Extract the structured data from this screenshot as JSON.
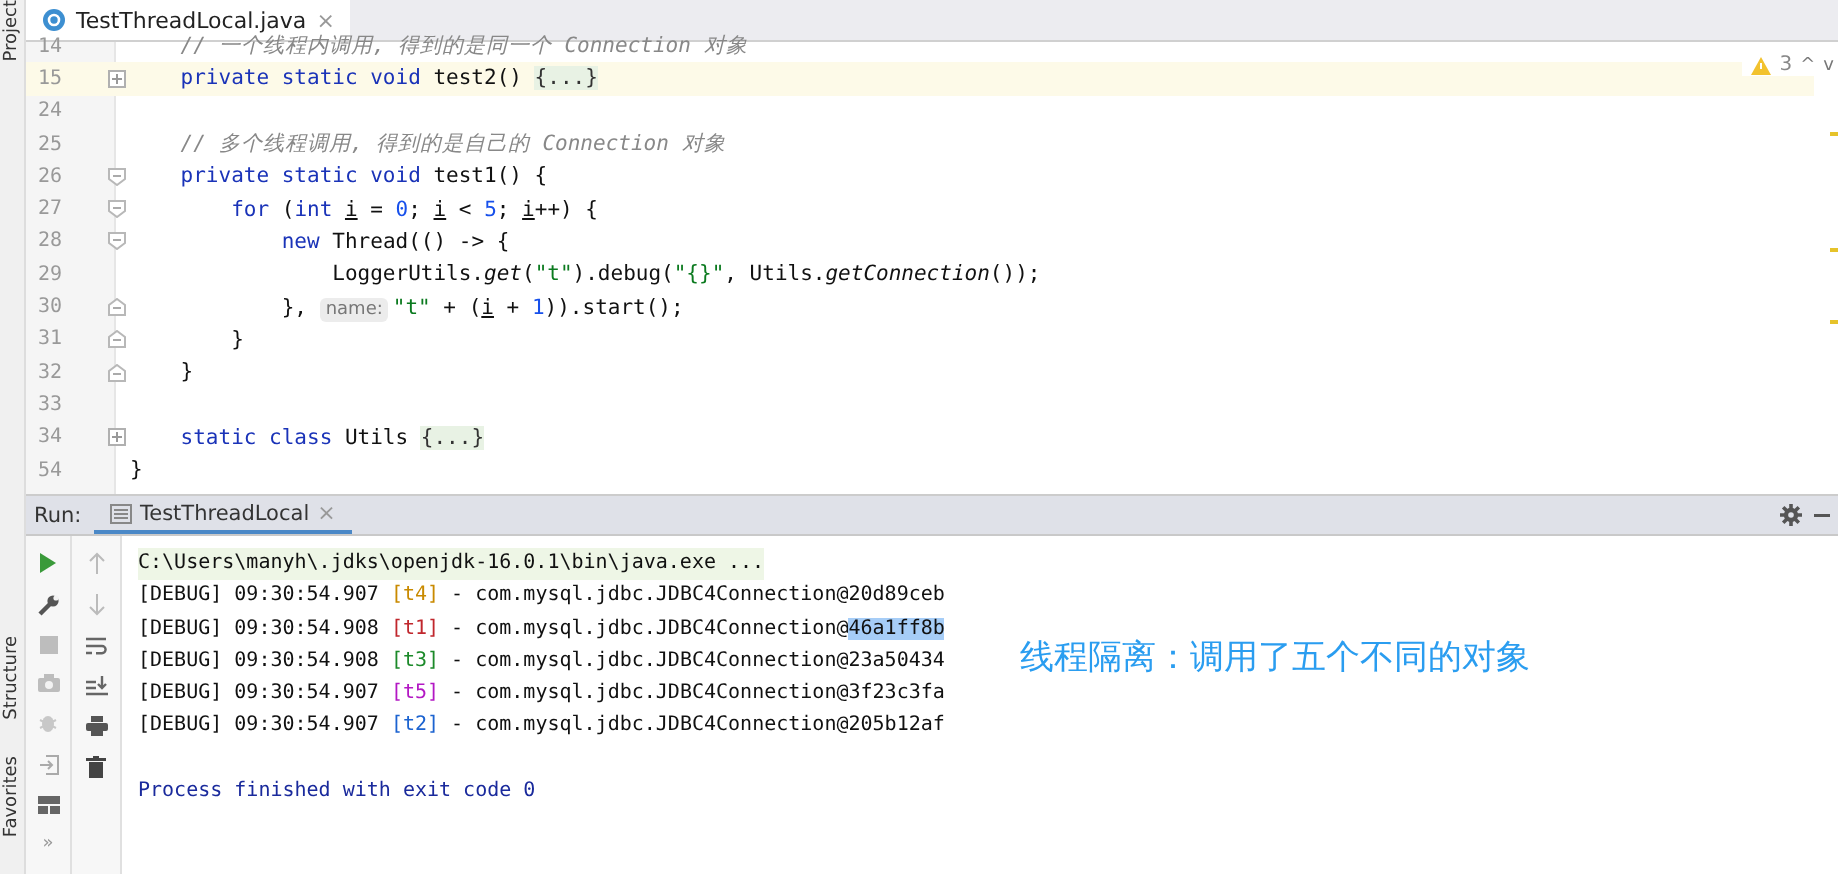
{
  "side_tools": [
    {
      "label": "Project"
    },
    {
      "label": "Structure"
    },
    {
      "label": "Favorites"
    }
  ],
  "tabs": [
    {
      "label": "TestThreadLocal.java",
      "selected": true,
      "close": "×"
    }
  ],
  "inspection": {
    "count": "3",
    "up": "^",
    "down": "v"
  },
  "editor": {
    "lines": [
      {
        "num": "14",
        "kind": "plain",
        "highlight": false,
        "segs": [
          {
            "kind": "comment",
            "text": "    // 一个线程内调用, 得到的是同一个 Connection 对象"
          }
        ]
      },
      {
        "num": "15",
        "kind": "fold_plus",
        "highlight": true,
        "segs": [
          {
            "kind": "kw",
            "text": "    private static void "
          },
          {
            "kind": "plain",
            "text": "test2() "
          },
          {
            "kind": "folded",
            "text": "{...}"
          }
        ]
      },
      {
        "num": "24",
        "kind": "plain",
        "highlight": false
      },
      {
        "num": "25",
        "kind": "plain",
        "highlight": false,
        "segs": [
          {
            "kind": "comment",
            "text": "    // 多个线程调用, 得到的是自己的 Connection 对象"
          }
        ]
      },
      {
        "num": "26",
        "kind": "fold_open",
        "highlight": false,
        "segs": [
          {
            "kind": "kw",
            "text": "    private static void "
          },
          {
            "kind": "plain",
            "text": "test1() {"
          }
        ]
      },
      {
        "num": "27",
        "kind": "fold_open",
        "highlight": false,
        "segs": [
          {
            "kind": "kw",
            "text": "        for "
          },
          {
            "kind": "plain",
            "text": "("
          },
          {
            "kind": "kw",
            "text": "int "
          },
          {
            "kind": "var",
            "text": "i"
          },
          {
            "kind": "plain",
            "text": " = "
          },
          {
            "kind": "num",
            "text": "0"
          },
          {
            "kind": "plain",
            "text": "; "
          },
          {
            "kind": "var",
            "text": "i"
          },
          {
            "kind": "plain",
            "text": " < "
          },
          {
            "kind": "num",
            "text": "5"
          },
          {
            "kind": "plain",
            "text": "; "
          },
          {
            "kind": "var",
            "text": "i"
          },
          {
            "kind": "plain",
            "text": "++) {"
          }
        ]
      },
      {
        "num": "28",
        "kind": "fold_open",
        "highlight": false,
        "segs": [
          {
            "kind": "kw",
            "text": "            new "
          },
          {
            "kind": "plain",
            "text": "Thread(() -> {"
          }
        ]
      },
      {
        "num": "29",
        "kind": "plain",
        "highlight": false,
        "segs": [
          {
            "kind": "plain",
            "text": "                LoggerUtils."
          },
          {
            "kind": "italic",
            "text": "get"
          },
          {
            "kind": "plain",
            "text": "("
          },
          {
            "kind": "str",
            "text": "\"t\""
          },
          {
            "kind": "plain",
            "text": ").debug("
          },
          {
            "kind": "str",
            "text": "\"{}\""
          },
          {
            "kind": "plain",
            "text": ", Utils."
          },
          {
            "kind": "italic",
            "text": "getConnection"
          },
          {
            "kind": "plain",
            "text": "());"
          }
        ]
      },
      {
        "num": "30",
        "kind": "fold_close",
        "highlight": false,
        "segs": [
          {
            "kind": "plain",
            "text": "            }, "
          },
          {
            "kind": "hint",
            "text": "name:"
          },
          {
            "kind": "str",
            "text": "\"t\""
          },
          {
            "kind": "plain",
            "text": " + ("
          },
          {
            "kind": "var",
            "text": "i"
          },
          {
            "kind": "plain",
            "text": " + "
          },
          {
            "kind": "num",
            "text": "1"
          },
          {
            "kind": "plain",
            "text": ")).start();"
          }
        ]
      },
      {
        "num": "31",
        "kind": "fold_close",
        "highlight": false,
        "segs": [
          {
            "kind": "plain",
            "text": "        }"
          }
        ]
      },
      {
        "num": "32",
        "kind": "fold_close",
        "highlight": false,
        "segs": [
          {
            "kind": "plain",
            "text": "    }"
          }
        ]
      },
      {
        "num": "33",
        "kind": "plain",
        "highlight": false
      },
      {
        "num": "34",
        "kind": "fold_plus",
        "highlight": false,
        "segs": [
          {
            "kind": "kw",
            "text": "    static class "
          },
          {
            "kind": "plain",
            "text": "Utils "
          },
          {
            "kind": "folded",
            "text": "{...}"
          }
        ]
      },
      {
        "num": "54",
        "kind": "plain",
        "highlight": false,
        "segs": [
          {
            "kind": "plain",
            "text": "}"
          }
        ]
      }
    ]
  },
  "run": {
    "label": "Run:",
    "tab": {
      "label": "TestThreadLocal",
      "selected": true,
      "close": "×"
    },
    "command": "C:\\Users\\manyh\\.jdks\\openjdk-16.0.1\\bin\\java.exe ...",
    "log": [
      {
        "prefix": "[DEBUG] 09:30:54.907 ",
        "thread": "[t4]",
        "color": "#c98a00",
        "message": " - com.mysql.jdbc.JDBC4Connection@",
        "address": "20d89ceb",
        "selected": false
      },
      {
        "prefix": "[DEBUG] 09:30:54.908 ",
        "thread": "[t1]",
        "color": "#c0272d",
        "message": " - com.mysql.jdbc.JDBC4Connection@",
        "address": "46a1ff8b",
        "selected": true
      },
      {
        "prefix": "[DEBUG] 09:30:54.908 ",
        "thread": "[t3]",
        "color": "#1c8a2a",
        "message": " - com.mysql.jdbc.JDBC4Connection@",
        "address": "23a50434",
        "selected": false
      },
      {
        "prefix": "[DEBUG] 09:30:54.907 ",
        "thread": "[t5]",
        "color": "#b318c4",
        "message": " - com.mysql.jdbc.JDBC4Connection@",
        "address": "3f23c3fa",
        "selected": false
      },
      {
        "prefix": "[DEBUG] 09:30:54.907 ",
        "thread": "[t2]",
        "color": "#1c63d0",
        "message": " - com.mysql.jdbc.JDBC4Connection@",
        "address": "205b12af",
        "selected": false
      }
    ],
    "exit": "Process finished with exit code 0",
    "more": "»"
  },
  "annotation": "线程隔离：调用了五个不同的对象"
}
